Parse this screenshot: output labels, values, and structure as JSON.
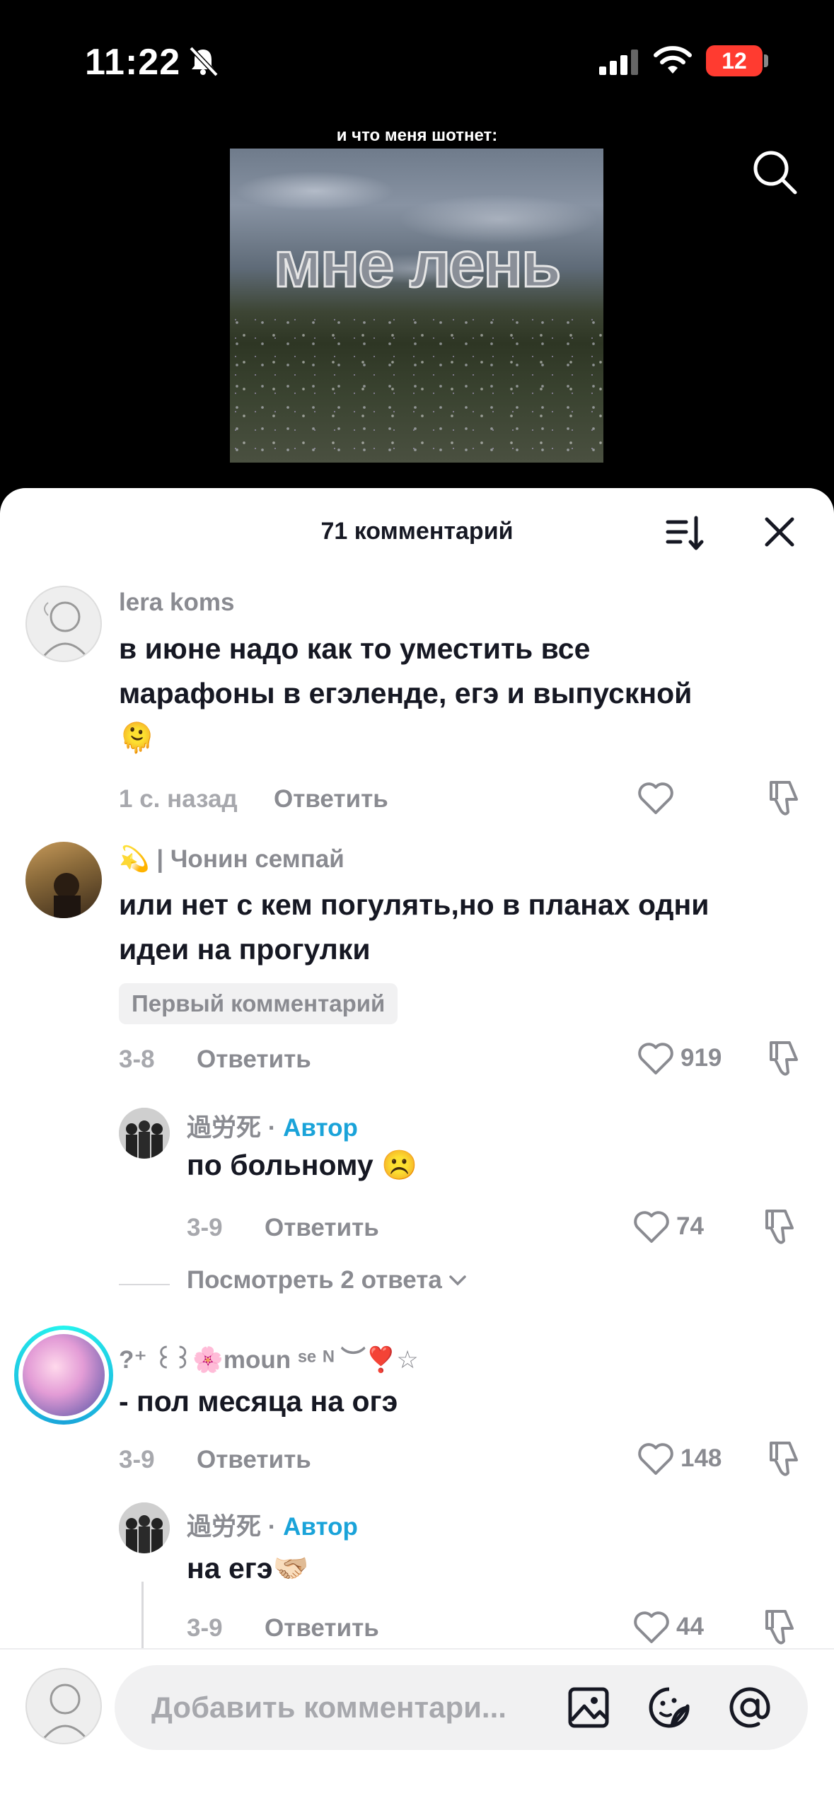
{
  "status_bar": {
    "time": "11:22",
    "battery": "12"
  },
  "video": {
    "caption": "и что меня шотнет:",
    "overlay_text": "мне лень"
  },
  "sheet": {
    "title": "71 комментарий"
  },
  "comments": [
    {
      "username": "lera koms",
      "text_line1": "в июне надо как то уместить все",
      "text_line2": "марафоны в егэленде, егэ и выпускной",
      "emoji": "🫠",
      "time": "1 с. назад",
      "reply_label": "Ответить",
      "likes": ""
    },
    {
      "username_prefix": "💫",
      "username": "| Чонин семпай",
      "text_line1": "или нет с кем погулять,но в планах одни",
      "text_line2": "идеи на прогулки",
      "badge": "Первый комментарий",
      "time": "3-8",
      "reply_label": "Ответить",
      "likes": "919",
      "reply": {
        "username": "過労死",
        "separator": " · ",
        "author_label": "Автор",
        "text": "по больному ☹️",
        "time": "3-9",
        "reply_label": "Ответить",
        "likes": "74"
      },
      "view_replies": "Посмотреть 2 ответа"
    },
    {
      "username": "?⁺ ꒰꒱🌸moun ˢᵉ ᴺ ︶❣️☆",
      "text_line1": "- пол месяца на огэ",
      "time": "3-9",
      "reply_label": "Ответить",
      "likes": "148",
      "reply": {
        "username": "過労死",
        "separator": " · ",
        "author_label": "Автор",
        "text": "на егэ🫱🏻‍🫲🏼",
        "time": "3-9",
        "reply_label": "Ответить",
        "likes": "44"
      }
    }
  ],
  "input": {
    "placeholder": "Добавить комментари..."
  },
  "icons": [
    "bell-slash-icon",
    "signal-icon",
    "wifi-icon",
    "search-icon",
    "sort-icon",
    "close-icon",
    "heart-icon",
    "dislike-icon",
    "image-icon",
    "sticker-icon",
    "mention-icon",
    "chevron-down-icon"
  ],
  "colors": {
    "author": "#1aa3d9",
    "battery": "#ff3b30",
    "muted": "#8a8b91"
  }
}
